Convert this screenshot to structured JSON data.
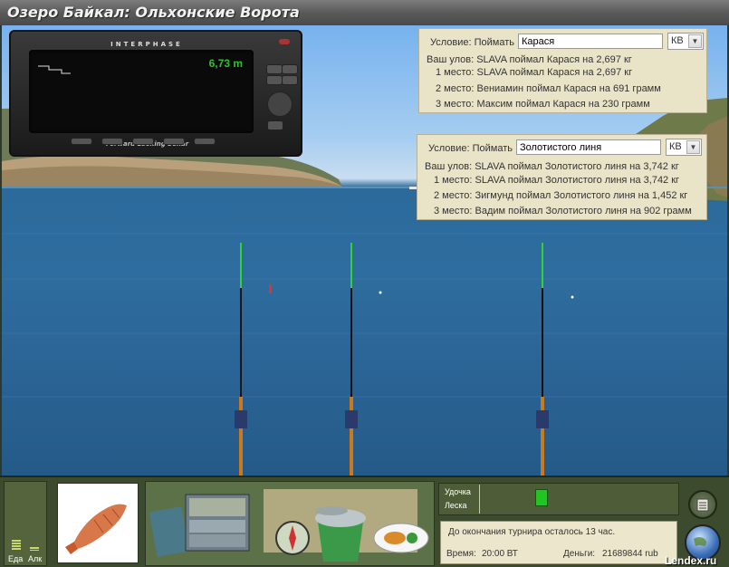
{
  "window": {
    "title": "Озеро Байкал: Ольхонские Ворота"
  },
  "sonar": {
    "brand": "INTERPHASE",
    "depth": "6,73 m",
    "caption": "Forward Looking Sonar"
  },
  "condition1": {
    "label": "Условие: Поймать",
    "fish": "Карася",
    "unit": "КВ",
    "your_catch": "Ваш улов: SLAVA поймал Карася на 2,697 кг",
    "place1": "1 место: SLAVA поймал Карася на 2,697 кг",
    "place2": "2 место: Вениамин поймал Карася на 691 грамм",
    "place3": "3 место: Максим поймал Карася на 230 грамм"
  },
  "condition2": {
    "label": "Условие: Поймать",
    "fish": "Золотистого линя",
    "unit": "КВ",
    "your_catch": "Ваш улов: SLAVA поймал Золотистого линя на 3,742 кг",
    "place1": "1 место: SLAVA поймал Золотистого линя на 3,742 кг",
    "place2": "2 место: Зигмунд поймал Золотистого линя на 1,452 кг",
    "place3": "3 место: Вадим поймал Золотистого линя на 902 грамм"
  },
  "meters": {
    "food": "Еда",
    "alc": "Алк"
  },
  "tension": {
    "rod": "Удочка",
    "line": "Леска"
  },
  "info": {
    "tournament": "До окончания турнира осталось 13 час.",
    "time_label": "Время:",
    "time_value": "20:00 ВТ",
    "money_label": "Деньги:",
    "money_value": "21689844 rub"
  },
  "watermark": "Lendex.ru",
  "icons": [
    "menu-icon",
    "globe-icon",
    "lure-icon",
    "compass-icon",
    "tackle-box-icon",
    "map-icon",
    "fish-bucket-icon",
    "food-plate-icon"
  ]
}
